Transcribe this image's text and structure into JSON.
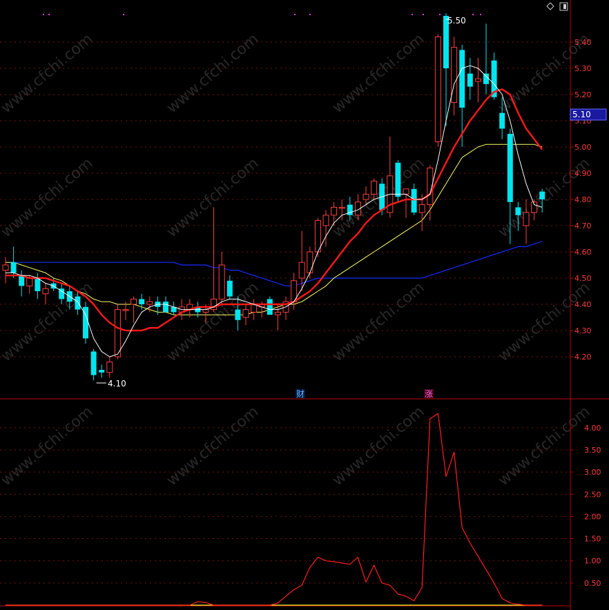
{
  "colors": {
    "background": "#000000",
    "axis": "#c00000",
    "grid": "#7a1010",
    "tick_text": "#ff3a3a",
    "candle_up": "#ff4040",
    "candle_down": "#00e5ee",
    "ma_fast": "#ffffff",
    "ma_10": "#ff1a1a",
    "ma_20": "#ffff66",
    "ma_60": "#1a2bff",
    "indicator_line": "#ff2020",
    "indicator_base": "#ffff33",
    "price_tag_bg": "#1a1aa0",
    "marker_cai": "#66b3ff",
    "marker_zhang": "#ff66cc",
    "top_dots": "#ff33ff",
    "watermark": "#5a5a5a"
  },
  "watermark_text": "www.cfchi.com",
  "icons": [
    "diamond-icon",
    "window-icon"
  ],
  "chart_data": [
    {
      "type": "candlestick",
      "title": "",
      "ylim": [
        4.1,
        5.52
      ],
      "yticks": [
        "5.40",
        "5.30",
        "5.20",
        "5.10",
        "5.00",
        "4.90",
        "4.80",
        "4.70",
        "4.60",
        "4.50",
        "4.40",
        "4.30",
        "4.20"
      ],
      "grid": true,
      "current_price_tag": "5.10",
      "annotations": {
        "high": "5.50",
        "low": "4.10"
      },
      "markers": [
        "财",
        "涨"
      ],
      "candles": [
        {
          "o": 4.53,
          "h": 4.58,
          "l": 4.48,
          "c": 4.55
        },
        {
          "o": 4.56,
          "h": 4.62,
          "l": 4.5,
          "c": 4.52
        },
        {
          "o": 4.51,
          "h": 4.53,
          "l": 4.43,
          "c": 4.47
        },
        {
          "o": 4.47,
          "h": 4.51,
          "l": 4.44,
          "c": 4.5
        },
        {
          "o": 4.5,
          "h": 4.52,
          "l": 4.42,
          "c": 4.45
        },
        {
          "o": 4.44,
          "h": 4.48,
          "l": 4.4,
          "c": 4.46
        },
        {
          "o": 4.48,
          "h": 4.5,
          "l": 4.45,
          "c": 4.46
        },
        {
          "o": 4.46,
          "h": 4.48,
          "l": 4.4,
          "c": 4.42
        },
        {
          "o": 4.45,
          "h": 4.47,
          "l": 4.38,
          "c": 4.41
        },
        {
          "o": 4.43,
          "h": 4.45,
          "l": 4.36,
          "c": 4.38
        },
        {
          "o": 4.39,
          "h": 4.41,
          "l": 4.25,
          "c": 4.27
        },
        {
          "o": 4.22,
          "h": 4.23,
          "l": 4.11,
          "c": 4.13
        },
        {
          "o": 4.15,
          "h": 4.17,
          "l": 4.12,
          "c": 4.14
        },
        {
          "o": 4.14,
          "h": 4.2,
          "l": 4.12,
          "c": 4.18
        },
        {
          "o": 4.2,
          "h": 4.4,
          "l": 4.19,
          "c": 4.38
        },
        {
          "o": 4.38,
          "h": 4.41,
          "l": 4.34,
          "c": 4.38
        },
        {
          "o": 4.4,
          "h": 4.43,
          "l": 4.33,
          "c": 4.42
        },
        {
          "o": 4.42,
          "h": 4.44,
          "l": 4.38,
          "c": 4.4
        },
        {
          "o": 4.4,
          "h": 4.43,
          "l": 4.37,
          "c": 4.41
        },
        {
          "o": 4.41,
          "h": 4.43,
          "l": 4.36,
          "c": 4.39
        },
        {
          "o": 4.41,
          "h": 4.43,
          "l": 4.38,
          "c": 4.37
        },
        {
          "o": 4.39,
          "h": 4.41,
          "l": 4.36,
          "c": 4.37
        },
        {
          "o": 4.37,
          "h": 4.42,
          "l": 4.34,
          "c": 4.39
        },
        {
          "o": 4.38,
          "h": 4.42,
          "l": 4.35,
          "c": 4.4
        },
        {
          "o": 4.39,
          "h": 4.41,
          "l": 4.35,
          "c": 4.37
        },
        {
          "o": 4.37,
          "h": 4.4,
          "l": 4.33,
          "c": 4.38
        },
        {
          "o": 4.38,
          "h": 4.77,
          "l": 4.37,
          "c": 4.42
        },
        {
          "o": 4.42,
          "h": 4.6,
          "l": 4.4,
          "c": 4.55
        },
        {
          "o": 4.49,
          "h": 4.51,
          "l": 4.42,
          "c": 4.43
        },
        {
          "o": 4.38,
          "h": 4.43,
          "l": 4.3,
          "c": 4.34
        },
        {
          "o": 4.35,
          "h": 4.4,
          "l": 4.32,
          "c": 4.38
        },
        {
          "o": 4.37,
          "h": 4.42,
          "l": 4.34,
          "c": 4.4
        },
        {
          "o": 4.39,
          "h": 4.41,
          "l": 4.35,
          "c": 4.4
        },
        {
          "o": 4.42,
          "h": 4.43,
          "l": 4.36,
          "c": 4.36
        },
        {
          "o": 4.36,
          "h": 4.4,
          "l": 4.3,
          "c": 4.37
        },
        {
          "o": 4.37,
          "h": 4.43,
          "l": 4.34,
          "c": 4.41
        },
        {
          "o": 4.41,
          "h": 4.52,
          "l": 4.38,
          "c": 4.49
        },
        {
          "o": 4.5,
          "h": 4.68,
          "l": 4.45,
          "c": 4.56
        },
        {
          "o": 4.52,
          "h": 4.62,
          "l": 4.5,
          "c": 4.6
        },
        {
          "o": 4.6,
          "h": 4.73,
          "l": 4.58,
          "c": 4.72
        },
        {
          "o": 4.7,
          "h": 4.76,
          "l": 4.62,
          "c": 4.74
        },
        {
          "o": 4.74,
          "h": 4.79,
          "l": 4.7,
          "c": 4.77
        },
        {
          "o": 4.77,
          "h": 4.8,
          "l": 4.72,
          "c": 4.77
        },
        {
          "o": 4.78,
          "h": 4.81,
          "l": 4.72,
          "c": 4.74
        },
        {
          "o": 4.74,
          "h": 4.82,
          "l": 4.72,
          "c": 4.79
        },
        {
          "o": 4.8,
          "h": 4.85,
          "l": 4.78,
          "c": 4.82
        },
        {
          "o": 4.82,
          "h": 4.88,
          "l": 4.8,
          "c": 4.87
        },
        {
          "o": 4.86,
          "h": 4.88,
          "l": 4.74,
          "c": 4.76
        },
        {
          "o": 4.75,
          "h": 5.04,
          "l": 4.73,
          "c": 4.89
        },
        {
          "o": 4.94,
          "h": 4.95,
          "l": 4.79,
          "c": 4.81
        },
        {
          "o": 4.82,
          "h": 4.84,
          "l": 4.73,
          "c": 4.84
        },
        {
          "o": 4.84,
          "h": 4.86,
          "l": 4.74,
          "c": 4.75
        },
        {
          "o": 4.75,
          "h": 4.82,
          "l": 4.68,
          "c": 4.78
        },
        {
          "o": 4.78,
          "h": 4.93,
          "l": 4.72,
          "c": 4.92
        },
        {
          "o": 5.02,
          "h": 5.43,
          "l": 5.0,
          "c": 5.42
        },
        {
          "o": 5.5,
          "h": 5.51,
          "l": 5.08,
          "c": 5.3
        },
        {
          "o": 5.17,
          "h": 5.42,
          "l": 5.12,
          "c": 5.38
        },
        {
          "o": 5.37,
          "h": 5.39,
          "l": 5.0,
          "c": 5.15
        },
        {
          "o": 5.28,
          "h": 5.34,
          "l": 5.18,
          "c": 5.23
        },
        {
          "o": 5.25,
          "h": 5.34,
          "l": 5.17,
          "c": 5.26
        },
        {
          "o": 5.28,
          "h": 5.47,
          "l": 5.2,
          "c": 5.24
        },
        {
          "o": 5.33,
          "h": 5.36,
          "l": 5.18,
          "c": 5.19
        },
        {
          "o": 5.13,
          "h": 5.19,
          "l": 5.03,
          "c": 5.07
        },
        {
          "o": 5.05,
          "h": 5.07,
          "l": 4.63,
          "c": 4.79
        },
        {
          "o": 4.77,
          "h": 4.79,
          "l": 4.68,
          "c": 4.74
        },
        {
          "o": 4.7,
          "h": 4.8,
          "l": 4.63,
          "c": 4.75
        },
        {
          "o": 4.75,
          "h": 4.8,
          "l": 4.72,
          "c": 4.79
        },
        {
          "o": 4.83,
          "h": 4.84,
          "l": 4.75,
          "c": 4.8
        }
      ],
      "ma_fast": [
        4.52,
        4.52,
        4.51,
        4.51,
        4.5,
        4.48,
        4.47,
        4.45,
        4.43,
        4.41,
        4.36,
        4.27,
        4.22,
        4.2,
        4.21,
        4.26,
        4.32,
        4.37,
        4.39,
        4.4,
        4.4,
        4.39,
        4.38,
        4.38,
        4.38,
        4.38,
        4.39,
        4.41,
        4.42,
        4.42,
        4.41,
        4.4,
        4.39,
        4.38,
        4.38,
        4.39,
        4.41,
        4.46,
        4.52,
        4.6,
        4.66,
        4.71,
        4.74,
        4.75,
        4.76,
        4.78,
        4.8,
        4.81,
        4.82,
        4.82,
        4.82,
        4.8,
        4.8,
        4.82,
        4.95,
        5.1,
        5.24,
        5.3,
        5.31,
        5.3,
        5.27,
        5.24,
        5.2,
        5.1,
        4.97,
        4.86,
        4.78,
        4.77
      ],
      "ma10": [
        4.51,
        4.51,
        4.51,
        4.5,
        4.5,
        4.5,
        4.49,
        4.48,
        4.47,
        4.45,
        4.43,
        4.4,
        4.36,
        4.33,
        4.31,
        4.3,
        4.3,
        4.3,
        4.31,
        4.31,
        4.33,
        4.35,
        4.37,
        4.38,
        4.39,
        4.39,
        4.39,
        4.4,
        4.4,
        4.4,
        4.4,
        4.4,
        4.4,
        4.4,
        4.4,
        4.4,
        4.41,
        4.43,
        4.45,
        4.48,
        4.52,
        4.56,
        4.6,
        4.64,
        4.67,
        4.71,
        4.74,
        4.76,
        4.78,
        4.79,
        4.8,
        4.8,
        4.8,
        4.82,
        4.88,
        4.94,
        5.0,
        5.05,
        5.1,
        5.14,
        5.18,
        5.21,
        5.22,
        5.2,
        5.13,
        5.07,
        5.03,
        4.99
      ],
      "ma20": [
        4.56,
        4.56,
        4.55,
        4.54,
        4.53,
        4.52,
        4.5,
        4.49,
        4.47,
        4.45,
        4.44,
        4.42,
        4.41,
        4.41,
        4.4,
        4.4,
        4.4,
        4.39,
        4.38,
        4.37,
        4.37,
        4.36,
        4.36,
        4.36,
        4.36,
        4.36,
        4.36,
        4.36,
        4.36,
        4.36,
        4.36,
        4.37,
        4.37,
        4.38,
        4.39,
        4.4,
        4.4,
        4.41,
        4.43,
        4.45,
        4.47,
        4.5,
        4.52,
        4.54,
        4.56,
        4.58,
        4.6,
        4.62,
        4.64,
        4.66,
        4.68,
        4.7,
        4.72,
        4.76,
        4.81,
        4.86,
        4.91,
        4.96,
        4.98,
        5.0,
        5.01,
        5.01,
        5.01,
        5.01,
        5.01,
        5.01,
        5.01,
        5.0
      ],
      "ma60": [
        4.56,
        4.56,
        4.56,
        4.56,
        4.56,
        4.56,
        4.56,
        4.56,
        4.56,
        4.56,
        4.56,
        4.56,
        4.56,
        4.56,
        4.56,
        4.56,
        4.56,
        4.56,
        4.56,
        4.56,
        4.56,
        4.56,
        4.55,
        4.55,
        4.55,
        4.55,
        4.54,
        4.54,
        4.53,
        4.53,
        4.52,
        4.51,
        4.5,
        4.49,
        4.48,
        4.47,
        4.47,
        4.48,
        4.49,
        4.5,
        4.5,
        4.5,
        4.5,
        4.5,
        4.5,
        4.5,
        4.5,
        4.5,
        4.5,
        4.5,
        4.5,
        4.5,
        4.5,
        4.51,
        4.52,
        4.53,
        4.54,
        4.55,
        4.56,
        4.57,
        4.58,
        4.59,
        4.6,
        4.61,
        4.62,
        4.62,
        4.63,
        4.64
      ]
    },
    {
      "type": "line",
      "title": "",
      "ylim": [
        0,
        4.4
      ],
      "yticks": [
        "4.00",
        "3.50",
        "3.00",
        "2.50",
        "2.00",
        "1.50",
        "1.00",
        "0.50"
      ],
      "grid": true,
      "series": [
        {
          "values": [
            0,
            0,
            0,
            0,
            0,
            0,
            0,
            0,
            0,
            0,
            0,
            0,
            0,
            0,
            0,
            0,
            0,
            0,
            0,
            0,
            0,
            0,
            0,
            0,
            0.08,
            0.06,
            0,
            0,
            0,
            0,
            0,
            0,
            0,
            0,
            0.05,
            0.2,
            0.35,
            0.45,
            0.85,
            1.08,
            1.0,
            0.98,
            0.95,
            0.92,
            1.08,
            0.52,
            0.9,
            0.5,
            0.45,
            0.25,
            0.2,
            0.1,
            0.4,
            4.2,
            4.32,
            2.9,
            3.45,
            1.75,
            1.4,
            1.1,
            0.8,
            0.5,
            0.15,
            0.05,
            0.02,
            0,
            0,
            0
          ]
        },
        {
          "values": [
            0,
            0,
            0,
            0,
            0,
            0,
            0,
            0,
            0,
            0,
            0,
            0,
            0,
            0,
            0,
            0,
            0,
            0,
            0,
            0,
            0,
            0,
            0,
            0,
            0,
            0,
            0,
            0,
            0,
            0,
            0,
            0,
            0,
            0,
            0,
            0,
            0,
            0,
            0,
            0,
            0,
            0,
            0,
            0,
            0,
            0,
            0,
            0,
            0,
            0,
            0,
            0,
            0,
            0,
            0,
            0,
            0,
            0,
            0,
            0,
            0,
            0,
            0,
            0,
            0,
            0,
            0,
            0
          ]
        }
      ]
    }
  ]
}
